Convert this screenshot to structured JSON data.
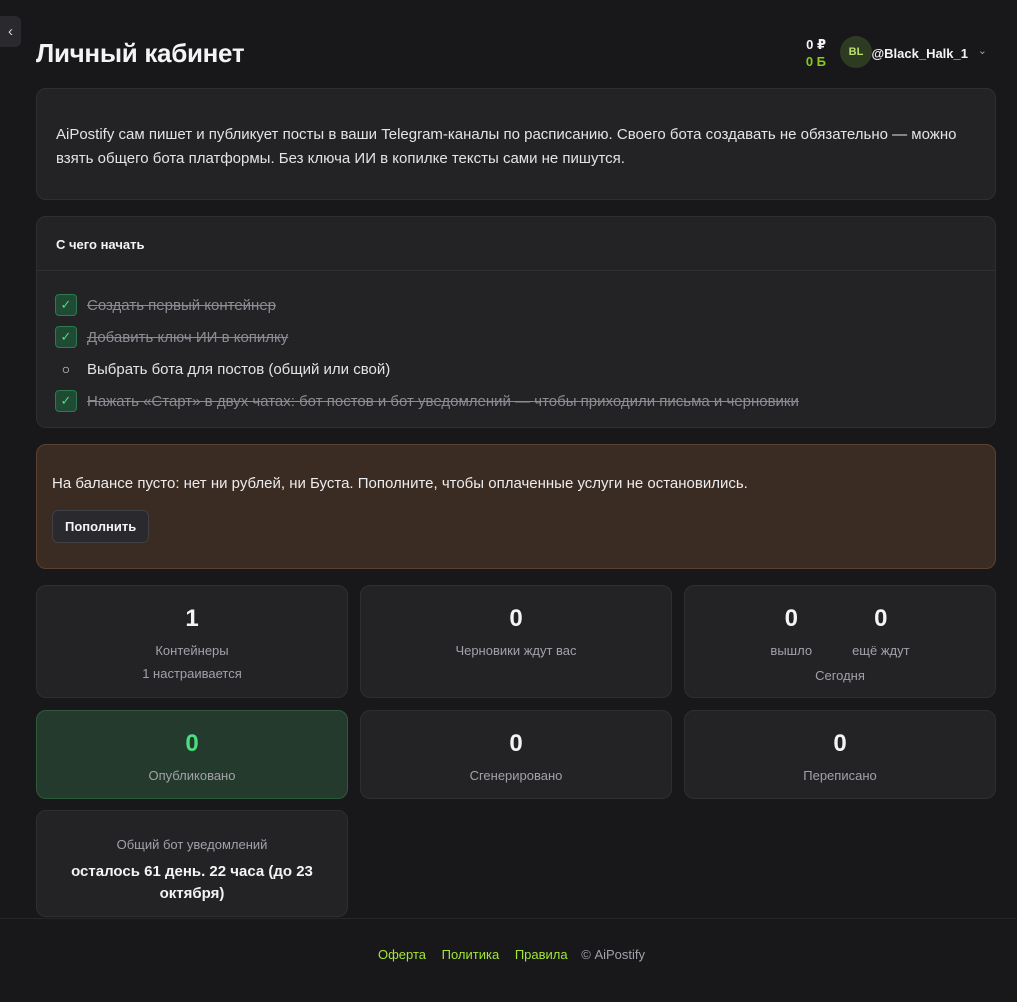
{
  "header": {
    "title": "Личный кабинет",
    "balance_rub": "0 ₽",
    "balance_boost": "0 Б",
    "avatar_initials": "BL",
    "username": "@Black_Halk_1"
  },
  "intro": {
    "text": "AiPostify сам пишет и публикует посты в ваши Telegram-каналы по расписанию. Своего бота создавать не обязательно — можно взять общего бота платформы. Без ключа ИИ в копилке тексты сами не пишутся."
  },
  "getting_started": {
    "title": "С чего начать",
    "items": [
      {
        "label": "Создать первый контейнер",
        "done": true
      },
      {
        "label": "Добавить ключ ИИ в копилку",
        "done": true
      },
      {
        "label": "Выбрать бота для постов (общий или свой)",
        "done": false
      },
      {
        "label": "Нажать «Старт» в двух чатах: бот постов и бот уведомлений — чтобы приходили письма и черновики",
        "done": true
      }
    ]
  },
  "warning": {
    "text": "На балансе пусто: нет ни рублей, ни Буста. Пополните, чтобы оплаченные услуги не остановились.",
    "button_label": "Пополнить"
  },
  "stats": {
    "containers": {
      "value": "1",
      "label": "Контейнеры",
      "sub": "1 настраивается"
    },
    "drafts": {
      "value": "0",
      "label": "Черновики ждут вас"
    },
    "today": {
      "out_value": "0",
      "out_label": "вышло",
      "waiting_value": "0",
      "waiting_label": "ещё ждут",
      "caption": "Сегодня"
    },
    "published": {
      "value": "0",
      "label": "Опубликовано"
    },
    "generated": {
      "value": "0",
      "label": "Сгенерировано"
    },
    "rewritten": {
      "value": "0",
      "label": "Переписано"
    },
    "notify_bot": {
      "label": "Общий бот уведомлений",
      "value": "осталось 61 день. 22 часа (до 23 октября)"
    }
  },
  "footer": {
    "offer": "Оферта",
    "policy": "Политика",
    "rules": "Правила",
    "copyright": "© AiPostify"
  },
  "icons": {
    "sidebar_toggle": "chevron-left-icon",
    "user_menu": "chevron-down-icon",
    "check": "check-icon",
    "todo": "circle-icon"
  },
  "colors": {
    "accent": "#84cc16",
    "success": "#4ade80",
    "warning_bg": "#3a2c22"
  }
}
